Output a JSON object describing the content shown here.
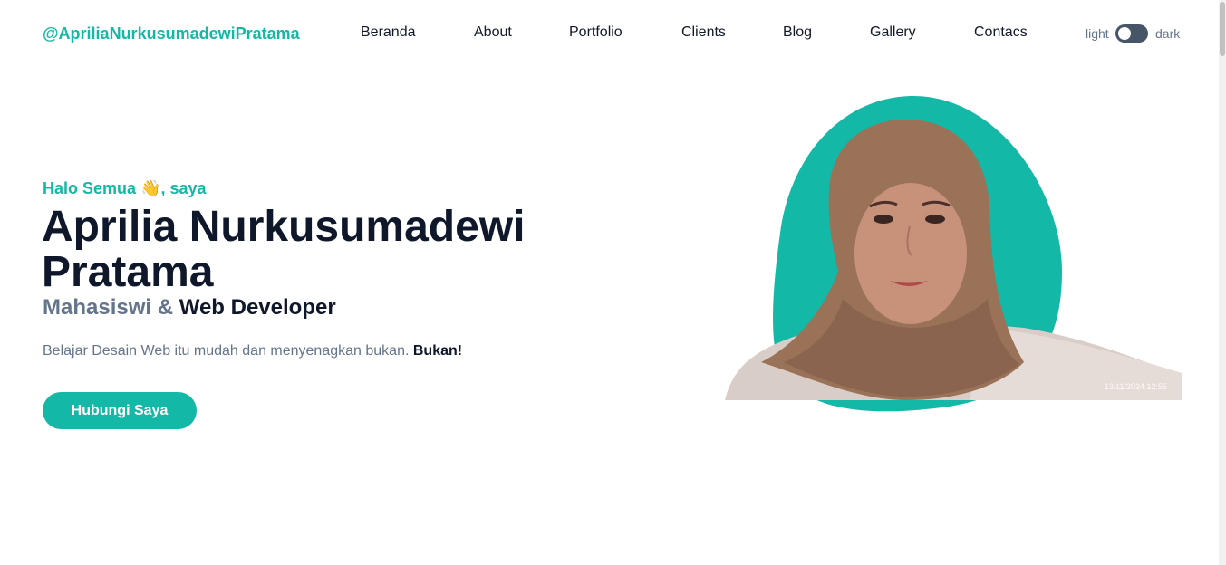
{
  "header": {
    "brand": "@ApriliaNurkusumadewiPratama",
    "nav": [
      {
        "label": "Beranda"
      },
      {
        "label": "About"
      },
      {
        "label": "Portfolio"
      },
      {
        "label": "Clients"
      },
      {
        "label": "Blog"
      },
      {
        "label": "Gallery"
      },
      {
        "label": "Contacs"
      }
    ],
    "theme": {
      "light": "light",
      "dark": "dark"
    }
  },
  "hero": {
    "greeting_prefix": "Halo Semua",
    "greeting_icon": "👋",
    "greeting_suffix": ", saya",
    "name": "Aprilia Nurkusumadewi Pratama",
    "role_a": "Mahasiswi & ",
    "role_b": "Web Developer",
    "description": "Belajar Desain Web itu mudah dan menyenagkan bukan. ",
    "description_bold": "Bukan!",
    "cta": "Hubungi Saya",
    "photo_timestamp": "13/11/2024 12:55"
  },
  "colors": {
    "accent": "#14b8a6",
    "text": "#0f172a",
    "muted": "#64748b"
  }
}
